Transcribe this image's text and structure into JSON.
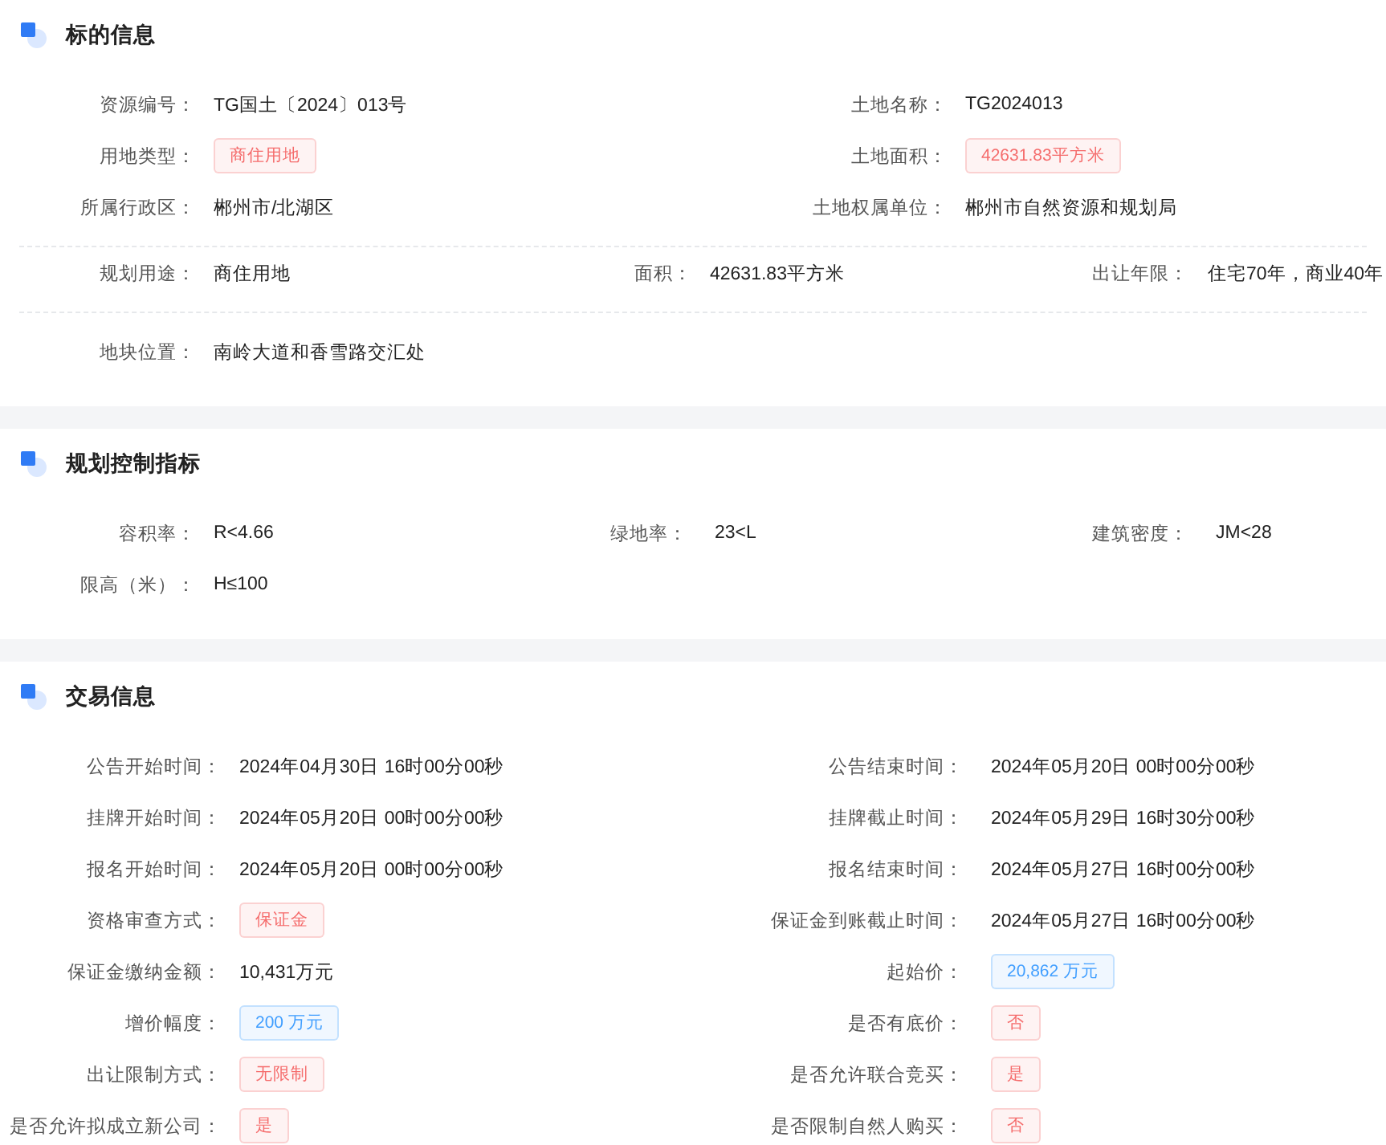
{
  "sections": [
    {
      "title": "标的信息",
      "groups": [
        [
          [
            {
              "label": "资源编号：",
              "kind": "text",
              "value": "TG国土〔2024〕013号"
            },
            {
              "label": "土地名称：",
              "kind": "text",
              "value": "TG2024013"
            }
          ],
          [
            {
              "label": "用地类型：",
              "kind": "tag",
              "color": "#f56c6c",
              "value": "商住用地"
            },
            {
              "label": "土地面积：",
              "kind": "tag",
              "color": "#f56c6c",
              "value": "42631.83平方米"
            }
          ],
          [
            {
              "label": "所属行政区：",
              "kind": "text",
              "value": "郴州市/北湖区"
            },
            {
              "label": "土地权属单位：",
              "kind": "text",
              "value": "郴州市自然资源和规划局"
            }
          ]
        ],
        [
          [
            {
              "label": "规划用途：",
              "kind": "text",
              "value": "商住用地"
            },
            {
              "label": "面积：",
              "kind": "text",
              "value": "42631.83平方米"
            },
            {
              "label": "出让年限：",
              "kind": "text",
              "value": "住宅70年，商业40年"
            }
          ]
        ],
        [
          [
            {
              "label": "地块位置：",
              "kind": "text",
              "value": "南岭大道和香雪路交汇处"
            }
          ]
        ]
      ]
    },
    {
      "title": "规划控制指标",
      "groups": [
        [
          [
            {
              "label": "容积率：",
              "kind": "text",
              "value": "R<4.66"
            },
            {
              "label": "绿地率：",
              "kind": "text",
              "value": "23<L"
            },
            {
              "label": "建筑密度：",
              "kind": "text",
              "value": "JM<28"
            }
          ],
          [
            {
              "label": "限高（米）：",
              "kind": "text",
              "value": "H≤100"
            }
          ]
        ]
      ]
    },
    {
      "title": "交易信息",
      "groups": [
        [
          [
            {
              "label": "公告开始时间：",
              "kind": "text",
              "value": "2024年04月30日 16时00分00秒"
            },
            {
              "label": "公告结束时间：",
              "kind": "text",
              "value": "2024年05月20日 00时00分00秒"
            }
          ],
          [
            {
              "label": "挂牌开始时间：",
              "kind": "text",
              "value": "2024年05月20日 00时00分00秒"
            },
            {
              "label": "挂牌截止时间：",
              "kind": "text",
              "value": "2024年05月29日 16时30分00秒"
            }
          ],
          [
            {
              "label": "报名开始时间：",
              "kind": "text",
              "value": "2024年05月20日 00时00分00秒"
            },
            {
              "label": "报名结束时间：",
              "kind": "text",
              "value": "2024年05月27日 16时00分00秒"
            }
          ],
          [
            {
              "label": "资格审查方式：",
              "kind": "tag",
              "color": "#f56c6c",
              "value": "保证金"
            },
            {
              "label": "保证金到账截止时间：",
              "kind": "text",
              "value": "2024年05月27日 16时00分00秒"
            }
          ],
          [
            {
              "label": "保证金缴纳金额：",
              "kind": "text",
              "value": "10,431万元"
            },
            {
              "label": "起始价：",
              "kind": "tag",
              "color": "#409eff",
              "value": "20,862 万元"
            }
          ],
          [
            {
              "label": "增价幅度：",
              "kind": "tag",
              "color": "#409eff",
              "value": "200 万元"
            },
            {
              "label": "是否有底价：",
              "kind": "tag",
              "color": "#f56c6c",
              "value": "否"
            }
          ],
          [
            {
              "label": "出让限制方式：",
              "kind": "tag",
              "color": "#f56c6c",
              "value": "无限制"
            },
            {
              "label": "是否允许联合竞买：",
              "kind": "tag",
              "color": "#f56c6c",
              "value": "是"
            }
          ],
          [
            {
              "label": "是否允许拟成立新公司：",
              "kind": "tag",
              "color": "#f56c6c",
              "value": "是"
            },
            {
              "label": "是否限制自然人购买：",
              "kind": "tag",
              "color": "#f56c6c",
              "value": "否"
            }
          ]
        ]
      ]
    }
  ]
}
